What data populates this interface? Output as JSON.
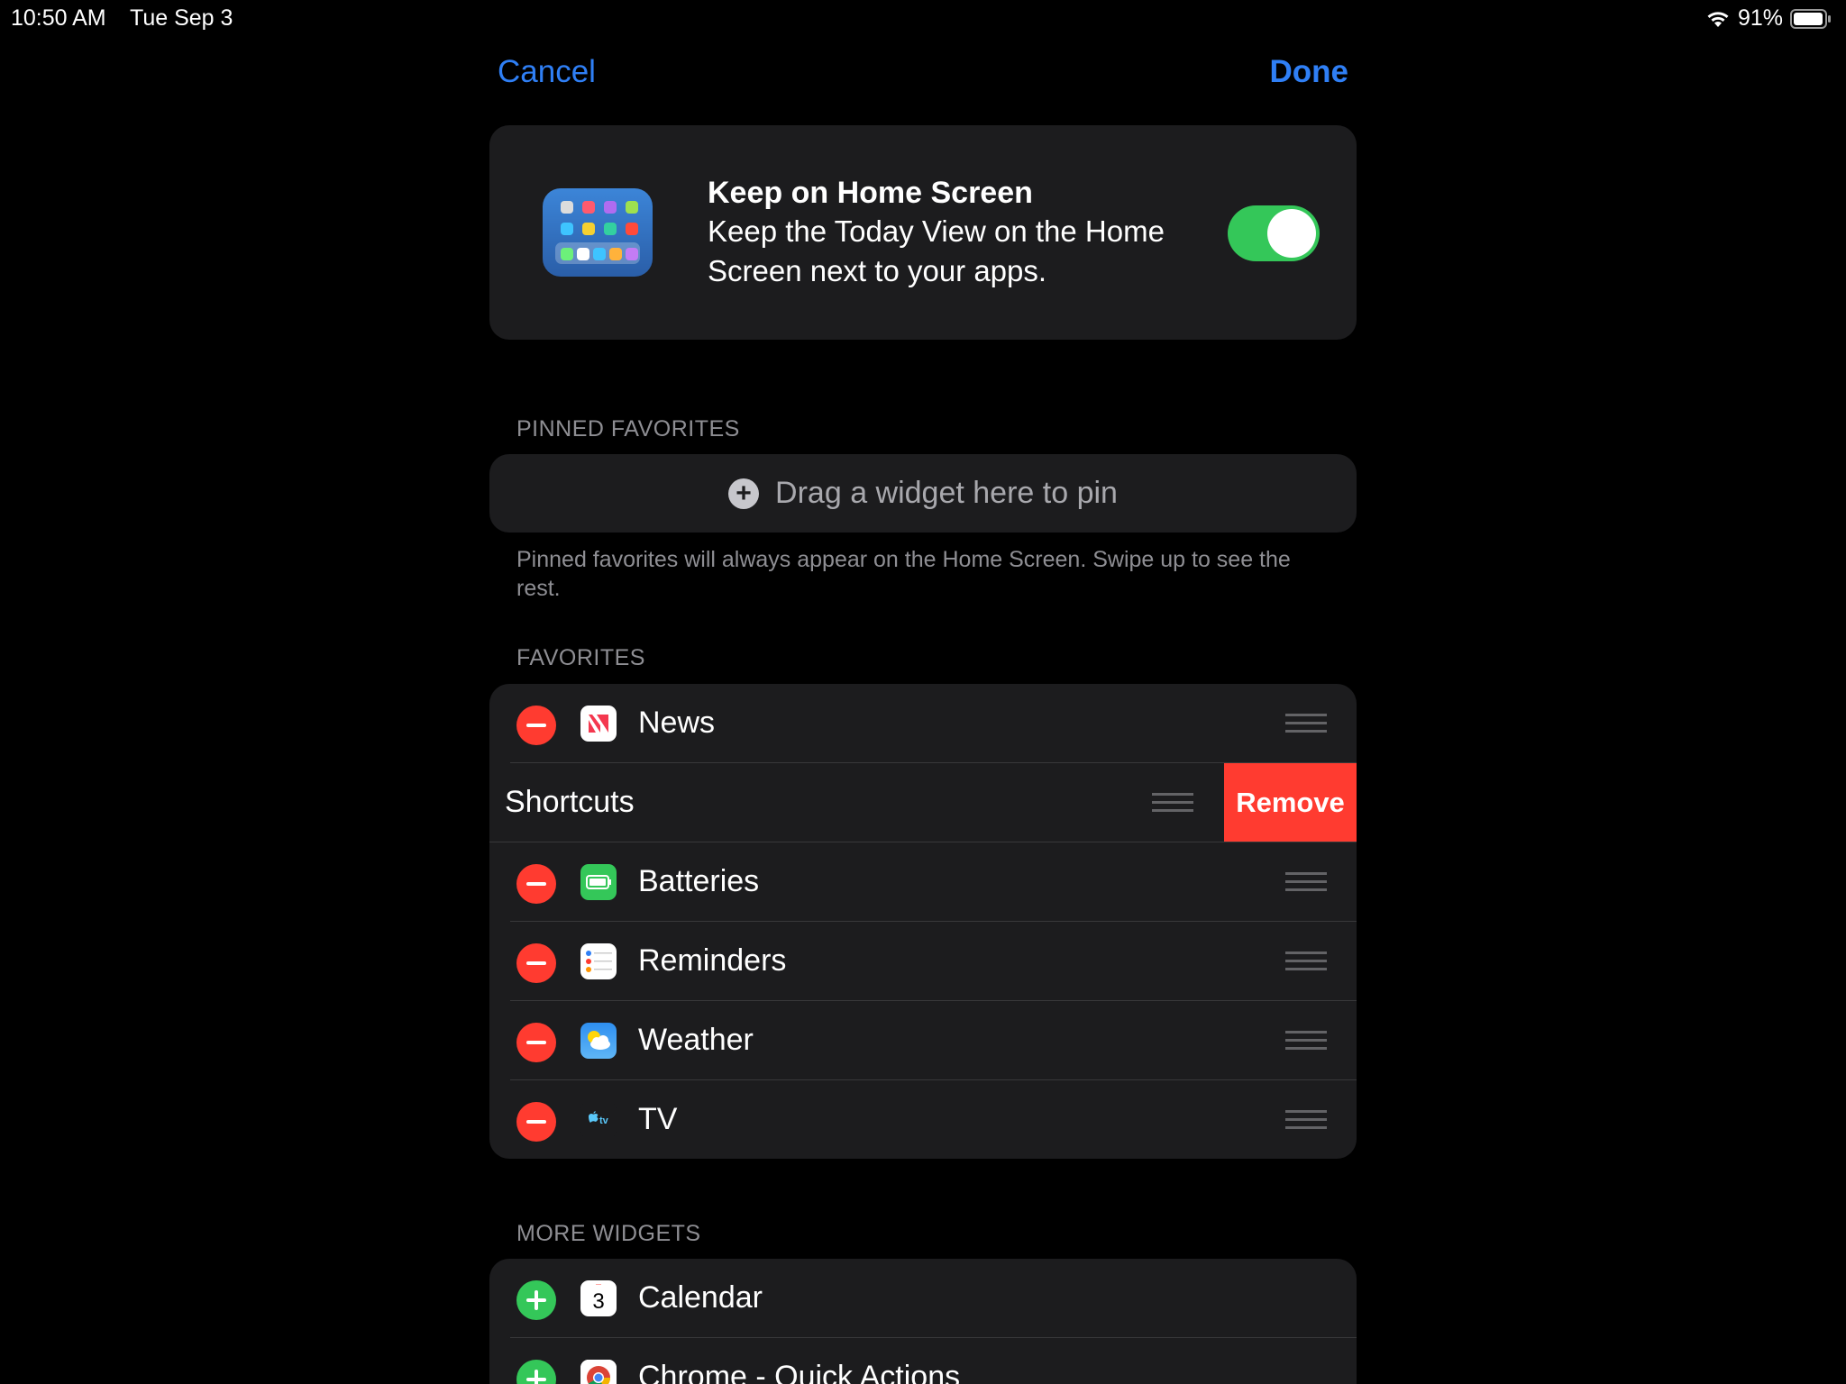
{
  "status_bar": {
    "time": "10:50 AM",
    "date": "Tue Sep 3",
    "battery": "91%"
  },
  "nav": {
    "cancel": "Cancel",
    "done": "Done"
  },
  "keep_home": {
    "title": "Keep on Home Screen",
    "description": "Keep the Today View on the Home Screen next to your apps.",
    "toggle_on": true,
    "toggle_color": "#34c759"
  },
  "pinned": {
    "header": "PINNED FAVORITES",
    "placeholder": "Drag a widget here to pin",
    "note": "Pinned favorites will always appear on the Home Screen. Swipe up to see the rest."
  },
  "favorites": {
    "header": "FAVORITES",
    "items": [
      {
        "label": "News",
        "icon": "news-icon"
      },
      {
        "label": "Shortcuts",
        "icon": "shortcuts-icon",
        "swiped": true,
        "action": "Remove"
      },
      {
        "label": "Batteries",
        "icon": "batteries-icon"
      },
      {
        "label": "Reminders",
        "icon": "reminders-icon"
      },
      {
        "label": "Weather",
        "icon": "weather-icon"
      },
      {
        "label": "TV",
        "icon": "tv-icon"
      }
    ]
  },
  "more_widgets": {
    "header": "MORE WIDGETS",
    "items": [
      {
        "label": "Calendar",
        "icon": "calendar-icon",
        "day": "3"
      },
      {
        "label": "Chrome - Quick Actions",
        "icon": "chrome-icon"
      }
    ]
  },
  "colors": {
    "accent": "#2f7ff5",
    "destructive": "#ff3b30",
    "add": "#34c759",
    "card": "#1c1c1e"
  }
}
